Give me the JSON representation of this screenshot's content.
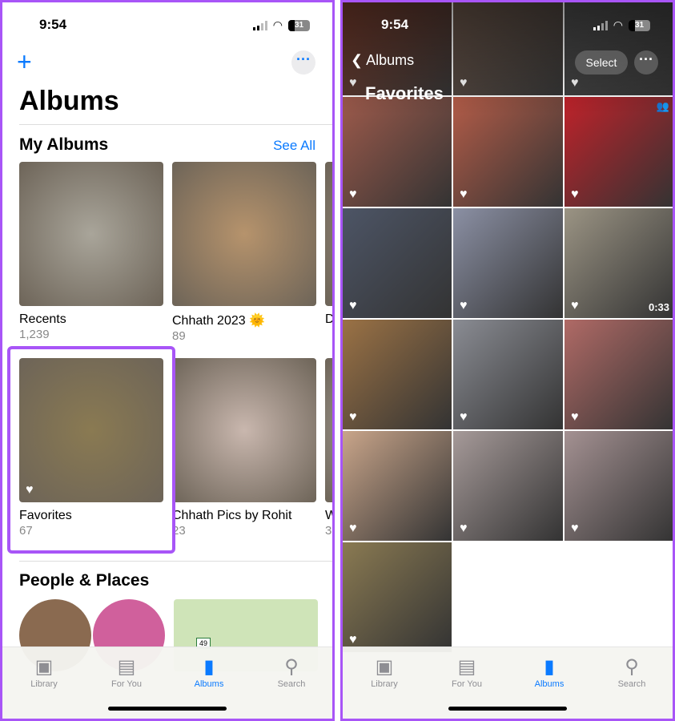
{
  "status": {
    "time": "9:54",
    "battery": "31"
  },
  "albums_screen": {
    "title": "Albums",
    "my_albums": {
      "heading": "My Albums",
      "see_all": "See All",
      "items": [
        {
          "name": "Recents",
          "count": "1,239",
          "color": "#a9a59a"
        },
        {
          "name": "Chhath 2023 🌞",
          "count": "89",
          "color": "#b6936c"
        },
        {
          "name": "D",
          "count": "",
          "color": "#9a8d7c"
        },
        {
          "name": "Favorites",
          "count": "67",
          "color": "#8a7a52",
          "favorite": true,
          "highlighted": true
        },
        {
          "name": "Chhath Pics by Rohit",
          "count": "23",
          "color": "#c9b7ae"
        },
        {
          "name": "W",
          "count": "3",
          "color": "#b5b0a8"
        }
      ]
    },
    "people_places": {
      "heading": "People & Places",
      "map_label": "49"
    }
  },
  "favorites_screen": {
    "back_label": "Albums",
    "title": "Favorites",
    "select_label": "Select",
    "photos": [
      {
        "color": "#7a3b2a"
      },
      {
        "color": "#6b5548"
      },
      {
        "color": "#4a4a4a"
      },
      {
        "color": "#9d5a4b"
      },
      {
        "color": "#b35c48"
      },
      {
        "color": "#c0222a",
        "shared": true
      },
      {
        "color": "#4d5566"
      },
      {
        "color": "#8b90a4"
      },
      {
        "color": "#9b9484",
        "duration": "0:33"
      },
      {
        "color": "#9b7245"
      },
      {
        "color": "#8a8c93"
      },
      {
        "color": "#b06a66"
      },
      {
        "color": "#c9a58a"
      },
      {
        "color": "#a69a99"
      },
      {
        "color": "#a49192"
      },
      {
        "color": "#8a7a52"
      }
    ]
  },
  "tabs": [
    {
      "label": "Library",
      "icon": "photo-library-icon"
    },
    {
      "label": "For You",
      "icon": "for-you-icon"
    },
    {
      "label": "Albums",
      "icon": "albums-icon",
      "active": true
    },
    {
      "label": "Search",
      "icon": "search-icon"
    }
  ],
  "colors": {
    "accent": "#0a7aff",
    "highlight": "#a855f7"
  }
}
